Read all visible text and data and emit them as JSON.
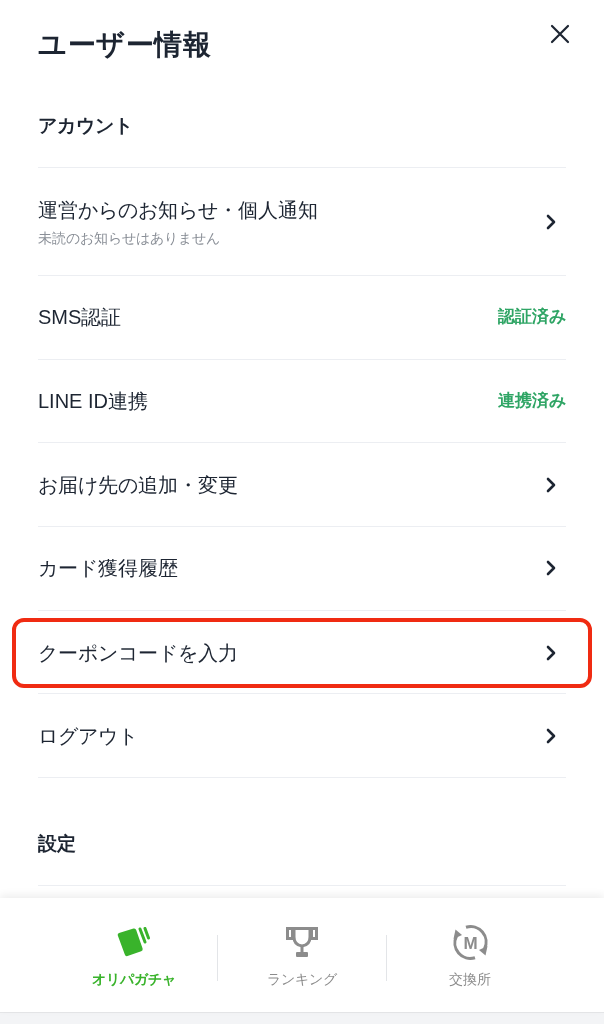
{
  "header": {
    "title": "ユーザー情報"
  },
  "sections": [
    {
      "title": "アカウント",
      "items": [
        {
          "kind": "link",
          "label": "運営からのお知らせ・個人通知",
          "subtitle": "未読のお知らせはありません",
          "highlighted": false
        },
        {
          "kind": "status",
          "label": "SMS認証",
          "status": "認証済み",
          "highlighted": false
        },
        {
          "kind": "status",
          "label": "LINE ID連携",
          "status": "連携済み",
          "highlighted": false
        },
        {
          "kind": "link",
          "label": "お届け先の追加・変更",
          "highlighted": false
        },
        {
          "kind": "link",
          "label": "カード獲得履歴",
          "highlighted": false
        },
        {
          "kind": "link",
          "label": "クーポンコードを入力",
          "highlighted": true
        },
        {
          "kind": "link",
          "label": "ログアウト",
          "highlighted": false
        }
      ]
    },
    {
      "title": "設定"
    }
  ],
  "bottom_nav": [
    {
      "kind": "cards",
      "label": "オリパガチャ",
      "selected": true
    },
    {
      "kind": "trophy",
      "label": "ランキング",
      "selected": false
    },
    {
      "kind": "exchange",
      "label": "交換所",
      "icon_letter": "M",
      "selected": false
    }
  ]
}
